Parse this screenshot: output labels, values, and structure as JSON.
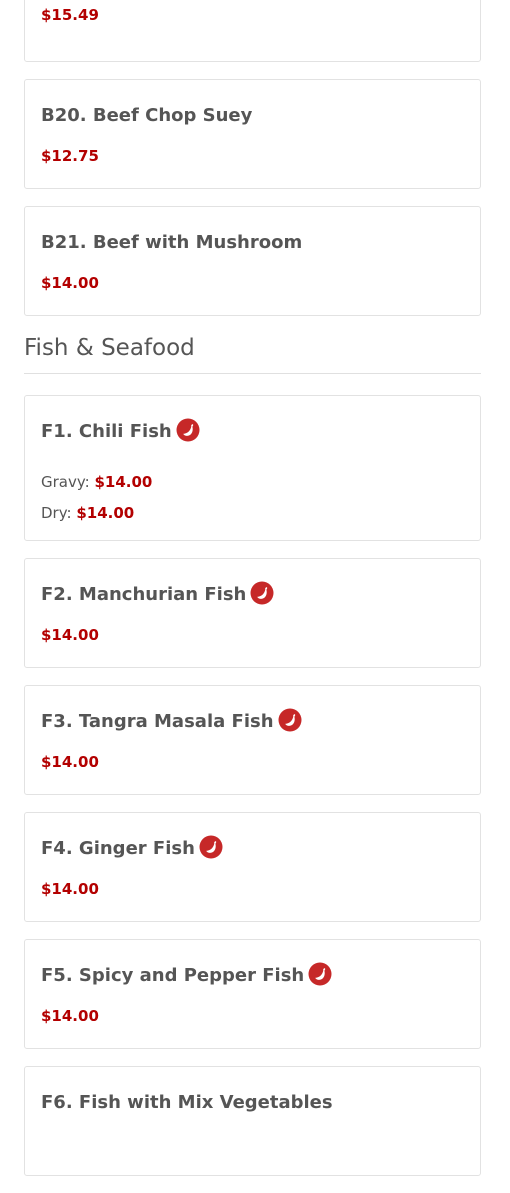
{
  "items_top": [
    {
      "price": "$15.49"
    },
    {
      "name": "B20. Beef Chop Suey",
      "price": "$12.75"
    },
    {
      "name": "B21. Beef with Mushroom",
      "price": "$14.00"
    }
  ],
  "section": {
    "title": "Fish & Seafood"
  },
  "fish": [
    {
      "name": "F1. Chili Fish",
      "spicy": true,
      "options": [
        {
          "label": "Gravy:",
          "price": "$14.00"
        },
        {
          "label": "Dry:",
          "price": "$14.00"
        }
      ]
    },
    {
      "name": "F2. Manchurian Fish",
      "spicy": true,
      "price": "$14.00"
    },
    {
      "name": "F3. Tangra Masala Fish",
      "spicy": true,
      "price": "$14.00"
    },
    {
      "name": "F4. Ginger Fish",
      "spicy": true,
      "price": "$14.00"
    },
    {
      "name": "F5. Spicy and Pepper Fish",
      "spicy": true,
      "price": "$14.00"
    },
    {
      "name": "F6. Fish with Mix Vegetables"
    }
  ],
  "icons": {
    "spicy": "chili-pepper-icon",
    "color": "#c62828"
  }
}
